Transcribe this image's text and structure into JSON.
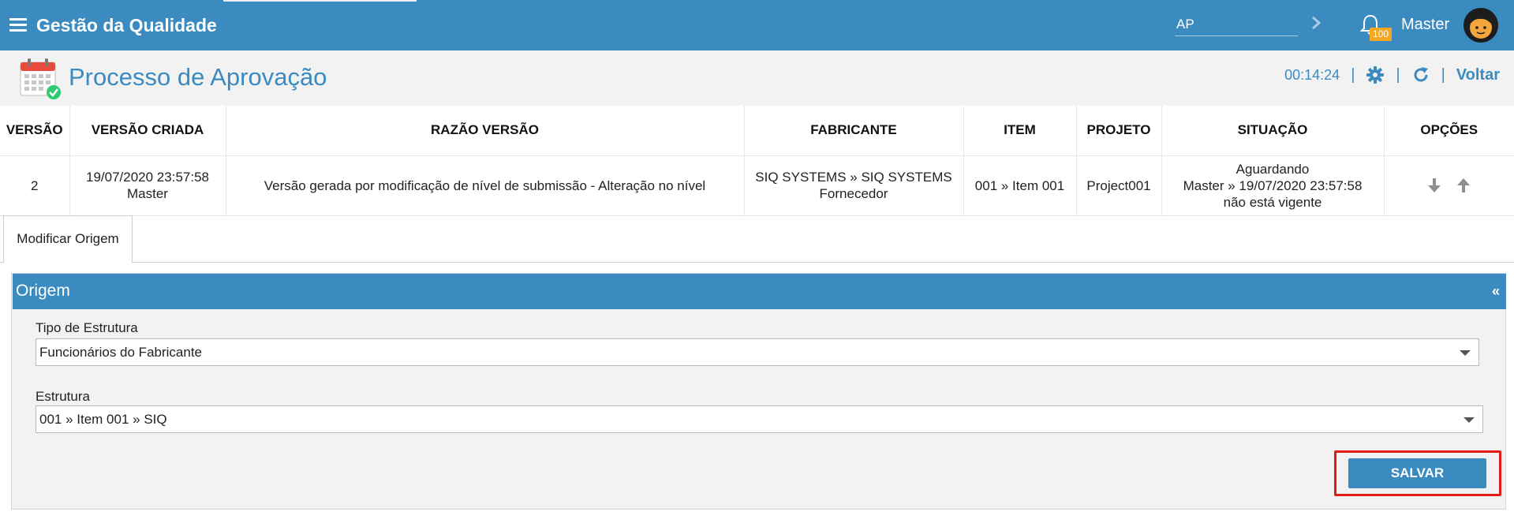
{
  "app": {
    "title": "Gestão da Qualidade",
    "search_value": "AP",
    "notifications_count": "100",
    "user_name": "Master"
  },
  "page": {
    "title": "Processo de Aprovação",
    "timer": "00:14:24",
    "back_label": "Voltar"
  },
  "table": {
    "columns": [
      "VERSÃO",
      "VERSÃO CRIADA",
      "RAZÃO VERSÃO",
      "FABRICANTE",
      "ITEM",
      "PROJETO",
      "SITUAÇÃO",
      "OPÇÕES"
    ],
    "rows": [
      {
        "versao": "2",
        "criada_data": "19/07/2020 23:57:58",
        "criada_usuario": "Master",
        "razao": "Versão gerada por modificação de nível de submissão - Alteração no nível",
        "fabricante_1": "SIQ SYSTEMS » SIQ SYSTEMS",
        "fabricante_2": "Fornecedor",
        "item": "001 » Item 001",
        "projeto": "Project001",
        "situacao_1": "Aguardando",
        "situacao_2": "Master » 19/07/2020 23:57:58",
        "situacao_3": "não está vigente"
      }
    ]
  },
  "tabs": [
    {
      "label": "Modificar Origem",
      "active": true
    }
  ],
  "panel": {
    "title": "Origem",
    "collapse_label": "«",
    "tipo_label": "Tipo de Estrutura",
    "tipo_value": "Funcionários do Fabricante",
    "estrutura_label": "Estrutura",
    "estrutura_value": "001 » Item 001 » SIQ",
    "save_label": "SALVAR"
  },
  "colors": {
    "primary": "#3b8bc0",
    "badge": "#f5a623",
    "highlight": "#e31b1b"
  }
}
